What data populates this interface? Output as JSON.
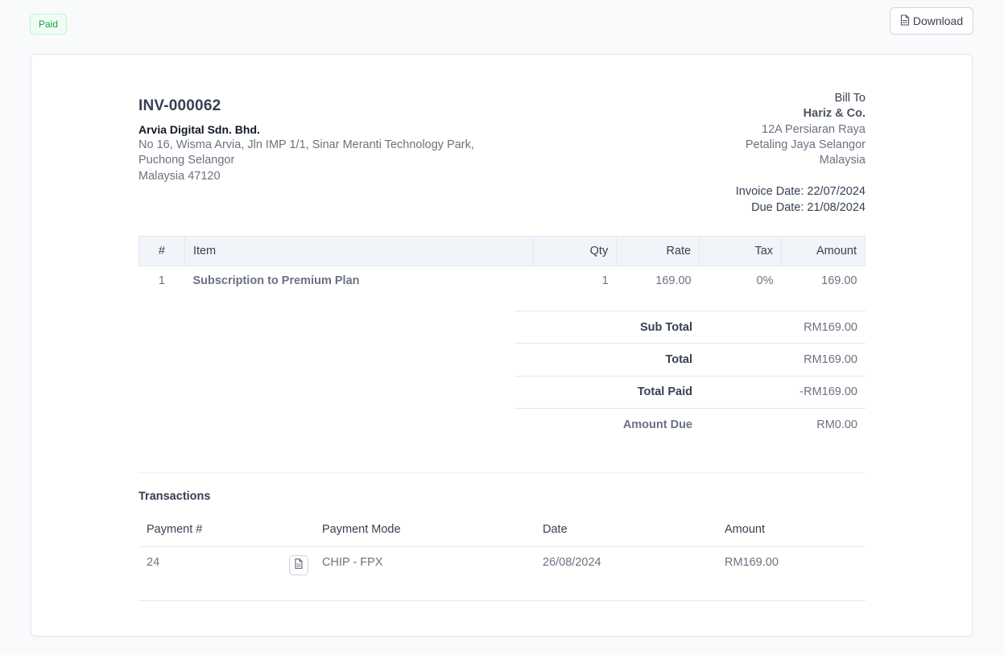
{
  "status": {
    "label": "Paid",
    "color": "#16a34a"
  },
  "toolbar": {
    "download_label": "Download",
    "download_icon": "file-pdf-icon"
  },
  "invoice": {
    "number": "INV-000062",
    "company": {
      "name": "Arvia Digital Sdn. Bhd.",
      "address_lines": [
        "No 16, Wisma Arvia, Jln IMP 1/1, Sinar Meranti Technology Park,",
        "Puchong Selangor",
        "Malaysia 47120"
      ]
    },
    "bill_to": {
      "label": "Bill To",
      "client": "Hariz & Co.",
      "address_lines": [
        "12A Persiaran Raya",
        "Petaling Jaya Selangor",
        "Malaysia"
      ]
    },
    "invoice_date": "Invoice Date: 22/07/2024",
    "due_date": "Due Date: 21/08/2024"
  },
  "items": {
    "columns": [
      "#",
      "Item",
      "Qty",
      "Rate",
      "Tax",
      "Amount"
    ],
    "rows": [
      {
        "num": "1",
        "item": "Subscription to Premium Plan",
        "qty": "1",
        "rate": "169.00",
        "tax": "0%",
        "amount": "169.00"
      }
    ]
  },
  "totals": [
    {
      "label": "Sub Total",
      "value": "RM169.00"
    },
    {
      "label": "Total",
      "value": "RM169.00"
    },
    {
      "label": "Total Paid",
      "value": "-RM169.00"
    },
    {
      "label": "Amount Due",
      "value": "RM0.00"
    }
  ],
  "transactions": {
    "title": "Transactions",
    "columns": [
      "Payment #",
      "Payment Mode",
      "Date",
      "Amount"
    ],
    "rows": [
      {
        "payment_no": "24",
        "mode": "CHIP - FPX",
        "date": "26/08/2024",
        "amount": "RM169.00",
        "receipt_icon": "file-pdf-icon"
      }
    ]
  }
}
